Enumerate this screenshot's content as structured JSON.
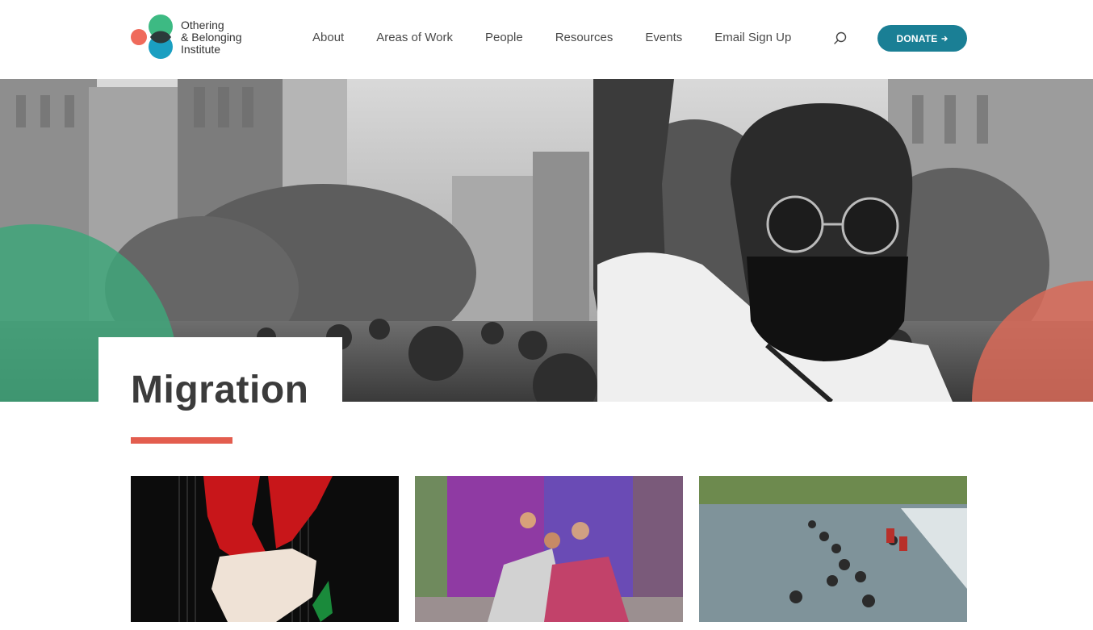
{
  "logo": {
    "line1": "Othering",
    "line2": "& Belonging",
    "line3": "Institute",
    "colors": {
      "coral": "#ef6a5b",
      "green": "#3dba83",
      "teal": "#1a9fc1",
      "overlap": "#2b3a3a"
    }
  },
  "nav": {
    "items": [
      "About",
      "Areas of Work",
      "People",
      "Resources",
      "Events",
      "Email Sign Up"
    ],
    "search_icon": "search-icon"
  },
  "donate": {
    "label": "DONATE",
    "icon": "arrow-right-icon",
    "color": "#1a7f95"
  },
  "hero": {
    "image": "black-and-white protest photo, masked man with raised fist",
    "accent_left": "#3fa67a",
    "accent_right": "#d96a58"
  },
  "page": {
    "title": "Migration",
    "accent_rule_color": "#e35d4e"
  },
  "cards": [
    {
      "image": "red-and-white eagle artwork on dark background"
    },
    {
      "image": "performers seated before purple drapes"
    },
    {
      "image": "people crossing a river"
    }
  ]
}
